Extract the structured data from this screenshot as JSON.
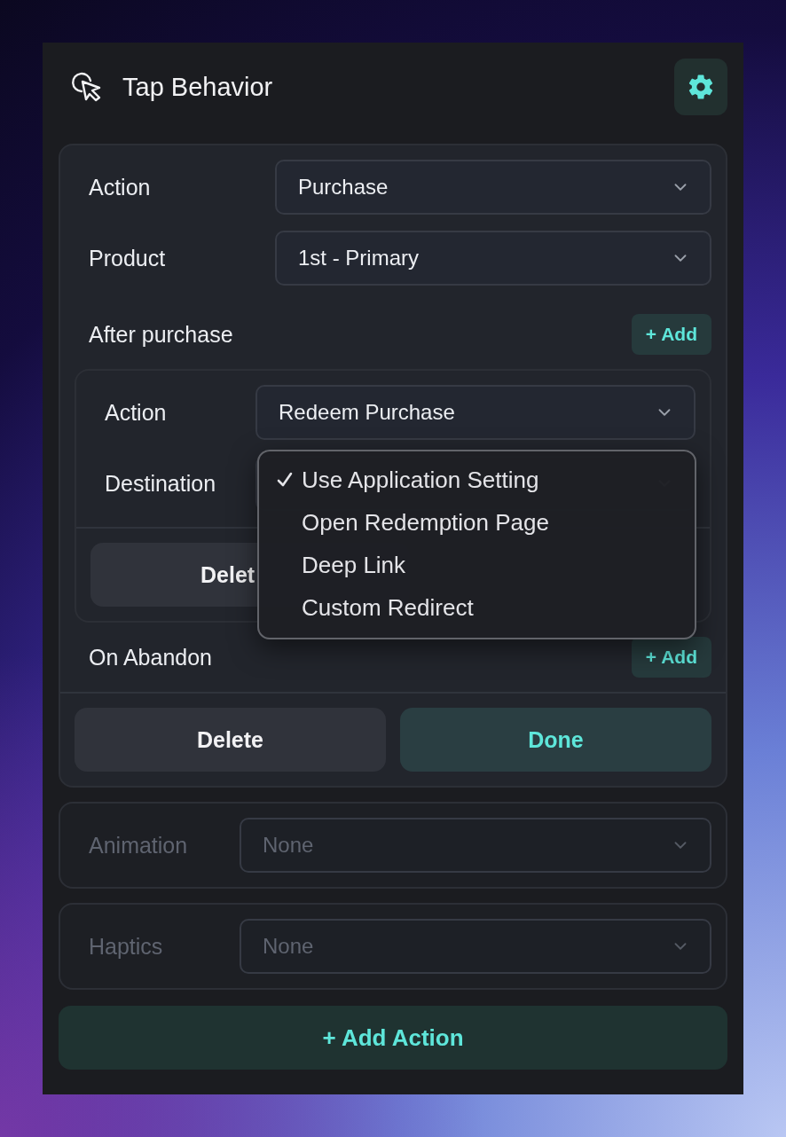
{
  "header": {
    "title": "Tap Behavior"
  },
  "action_card": {
    "fields": [
      {
        "label": "Action",
        "value": "Purchase"
      },
      {
        "label": "Product",
        "value": "1st - Primary"
      }
    ],
    "after_purchase": {
      "label": "After purchase",
      "add_button": "+ Add",
      "nested": {
        "fields": [
          {
            "label": "Action",
            "value": "Redeem Purchase"
          },
          {
            "label": "Destination"
          }
        ],
        "delete_button": "Delet",
        "menu": [
          {
            "label": "Use Application Setting",
            "selected": true
          },
          {
            "label": "Open Redemption Page",
            "selected": false
          },
          {
            "label": "Deep Link",
            "selected": false
          },
          {
            "label": "Custom Redirect",
            "selected": false
          }
        ]
      }
    },
    "on_abandon": {
      "label": "On Abandon",
      "add_button": "+ Add"
    },
    "delete_button": "Delete",
    "done_button": "Done"
  },
  "settings": [
    {
      "label": "Animation",
      "value": "None",
      "disabled": true
    },
    {
      "label": "Haptics",
      "value": "None",
      "disabled": true
    }
  ],
  "add_action_button": "+ Add Action"
}
